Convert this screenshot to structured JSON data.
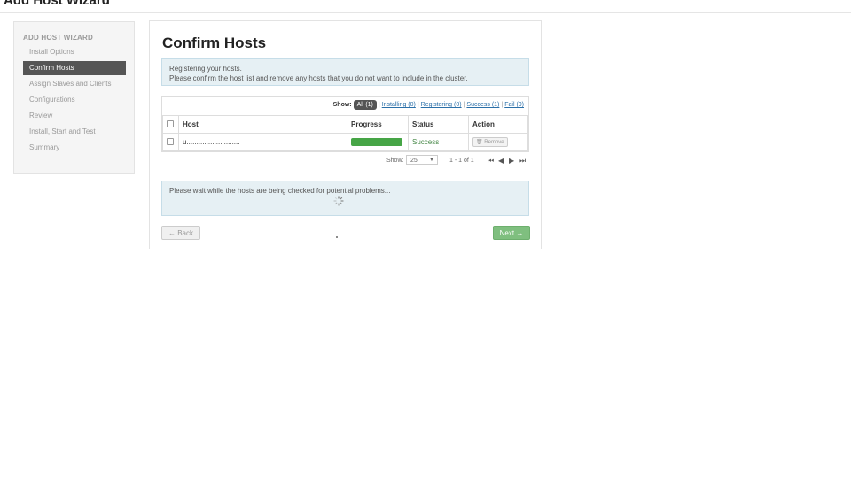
{
  "window": {
    "title": "Add Host Wizard"
  },
  "sidebar": {
    "header": "ADD HOST WIZARD",
    "items": [
      {
        "label": "Install Options"
      },
      {
        "label": "Confirm Hosts"
      },
      {
        "label": "Assign Slaves and Clients"
      },
      {
        "label": "Configurations"
      },
      {
        "label": "Review"
      },
      {
        "label": "Install, Start and Test"
      },
      {
        "label": "Summary"
      }
    ]
  },
  "main": {
    "title": "Confirm Hosts",
    "info": {
      "line1": "Registering your hosts.",
      "line2": "Please confirm the host list and remove any hosts that you do not want to include in the cluster."
    },
    "filters": {
      "label": "Show:",
      "all": "All (1)",
      "installing": "Installing (0)",
      "registering": "Registering (0)",
      "success": "Success (1)",
      "fail": "Fail (0)"
    },
    "table": {
      "columns": [
        "Host",
        "Progress",
        "Status",
        "Action"
      ],
      "rows": [
        {
          "host": "u...........................",
          "progress": 100,
          "status": "Success",
          "action": "Remove"
        }
      ]
    },
    "pager": {
      "show_label": "Show:",
      "page_size": "25",
      "range": "1 - 1 of 1"
    },
    "check_message": "Please wait while the hosts are being checked for potential problems...",
    "buttons": {
      "back": "← Back",
      "next": "Next →"
    }
  },
  "colors": {
    "active_nav": "#555555",
    "success": "#46a546",
    "alert_bg": "#e6f0f4",
    "next_button": "#7fbf7f"
  }
}
